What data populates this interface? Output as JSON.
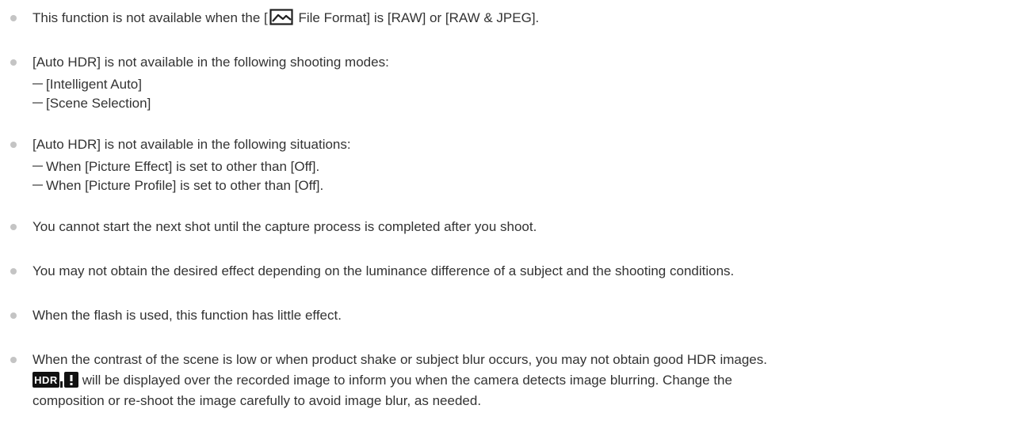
{
  "notes": [
    {
      "before": "This function is not available when the [",
      "icon": "file-format-icon",
      "after": " File Format] is [RAW] or [RAW & JPEG]."
    },
    {
      "text": "[Auto HDR] is not available in the following shooting modes:",
      "sub": [
        "[Intelligent Auto]",
        "[Scene Selection]"
      ]
    },
    {
      "text": "[Auto HDR] is not available in the following situations:",
      "sub": [
        "When [Picture Effect] is set to other than [Off].",
        "When [Picture Profile] is set to other than [Off]."
      ]
    },
    {
      "text": "You cannot start the next shot until the capture process is completed after you shoot."
    },
    {
      "text": "You may not obtain the desired effect depending on the luminance difference of a subject and the shooting conditions."
    },
    {
      "text": "When the flash is used, this function has little effect."
    },
    {
      "line1": "When the contrast of the scene is low or when product shake or subject blur occurs, you may not obtain good HDR images.",
      "icon": "hdr-warning-icon",
      "icon_text": "HDR",
      "line2": " will be displayed over the recorded image to inform you when the camera detects image blurring. Change the",
      "line3": "composition or re-shoot the image carefully to avoid image blur, as needed."
    }
  ]
}
